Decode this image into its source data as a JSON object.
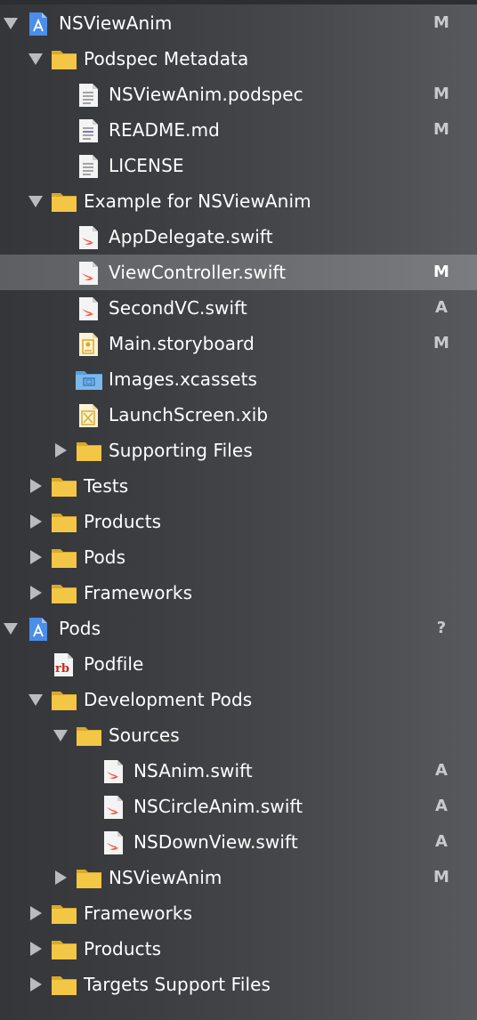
{
  "navigator": {
    "rows": [
      {
        "label": "NSViewAnim",
        "status": "M",
        "icon": "xcode-project-icon",
        "disclosure": "open"
      },
      {
        "label": "Podspec Metadata",
        "status": "",
        "icon": "folder-icon",
        "disclosure": "open"
      },
      {
        "label": "NSViewAnim.podspec",
        "status": "M",
        "icon": "text-file-icon",
        "disclosure": ""
      },
      {
        "label": "README.md",
        "status": "M",
        "icon": "markdown-file-icon",
        "disclosure": ""
      },
      {
        "label": "LICENSE",
        "status": "",
        "icon": "text-file-icon",
        "disclosure": ""
      },
      {
        "label": "Example for NSViewAnim",
        "status": "",
        "icon": "folder-icon",
        "disclosure": "open"
      },
      {
        "label": "AppDelegate.swift",
        "status": "",
        "icon": "swift-file-icon",
        "disclosure": ""
      },
      {
        "label": "ViewController.swift",
        "status": "M",
        "icon": "swift-file-icon",
        "disclosure": "",
        "selected": true
      },
      {
        "label": "SecondVC.swift",
        "status": "A",
        "icon": "swift-file-icon",
        "disclosure": ""
      },
      {
        "label": "Main.storyboard",
        "status": "M",
        "icon": "storyboard-file-icon",
        "disclosure": ""
      },
      {
        "label": "Images.xcassets",
        "status": "",
        "icon": "asset-catalog-icon",
        "disclosure": ""
      },
      {
        "label": "LaunchScreen.xib",
        "status": "",
        "icon": "xib-file-icon",
        "disclosure": ""
      },
      {
        "label": "Supporting Files",
        "status": "",
        "icon": "folder-icon",
        "disclosure": "closed"
      },
      {
        "label": "Tests",
        "status": "",
        "icon": "folder-icon",
        "disclosure": "closed"
      },
      {
        "label": "Products",
        "status": "",
        "icon": "folder-icon",
        "disclosure": "closed"
      },
      {
        "label": "Pods",
        "status": "",
        "icon": "folder-icon",
        "disclosure": "closed"
      },
      {
        "label": "Frameworks",
        "status": "",
        "icon": "folder-icon",
        "disclosure": "closed"
      },
      {
        "label": "Pods",
        "status": "?",
        "icon": "xcode-project-icon",
        "disclosure": "open"
      },
      {
        "label": "Podfile",
        "status": "",
        "icon": "ruby-file-icon",
        "disclosure": ""
      },
      {
        "label": "Development Pods",
        "status": "",
        "icon": "folder-icon",
        "disclosure": "open"
      },
      {
        "label": "Sources",
        "status": "",
        "icon": "folder-icon",
        "disclosure": "open"
      },
      {
        "label": "NSAnim.swift",
        "status": "A",
        "icon": "swift-file-icon",
        "disclosure": ""
      },
      {
        "label": "NSCircleAnim.swift",
        "status": "A",
        "icon": "swift-file-icon",
        "disclosure": ""
      },
      {
        "label": "NSDownView.swift",
        "status": "A",
        "icon": "swift-file-icon",
        "disclosure": ""
      },
      {
        "label": "NSViewAnim",
        "status": "M",
        "icon": "folder-icon",
        "disclosure": "closed"
      },
      {
        "label": "Frameworks",
        "status": "",
        "icon": "folder-icon",
        "disclosure": "closed"
      },
      {
        "label": "Products",
        "status": "",
        "icon": "folder-icon",
        "disclosure": "closed"
      },
      {
        "label": "Targets Support Files",
        "status": "",
        "icon": "folder-icon",
        "disclosure": "closed"
      }
    ]
  },
  "colors": {
    "folder": "#f3c646",
    "folder_dark": "#d9a92a",
    "swift": "#f05138",
    "project_blue": "#4a8ee8",
    "asset_blue": "#7ab8ec",
    "ruby_red": "#c4281c",
    "selection": "#6c6e72"
  }
}
